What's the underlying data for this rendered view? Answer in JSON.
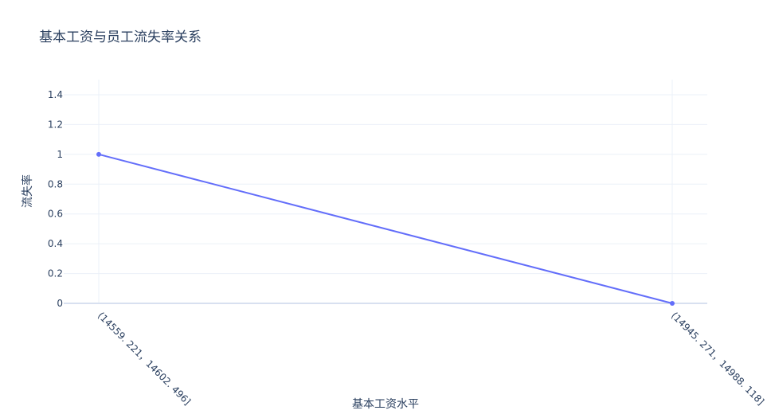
{
  "chart_data": {
    "type": "line",
    "title": "基本工资与员工流失率关系",
    "xlabel": "基本工资水平",
    "ylabel": "流失率",
    "categories": [
      "(14559. 221，14602. 496]",
      "(14945. 271，14988. 118]"
    ],
    "series": [
      {
        "values": [
          1,
          0
        ],
        "color": "#636efa"
      }
    ],
    "ylim": [
      0,
      1.4
    ],
    "yticks": [
      0,
      0.2,
      0.4,
      0.6,
      0.8,
      1,
      1.2,
      1.4
    ],
    "ytick_labels": [
      "0",
      "0.2",
      "0.4",
      "0.6",
      "0.8",
      "1",
      "1.2",
      "1.4"
    ],
    "grid": true,
    "markers": true
  }
}
